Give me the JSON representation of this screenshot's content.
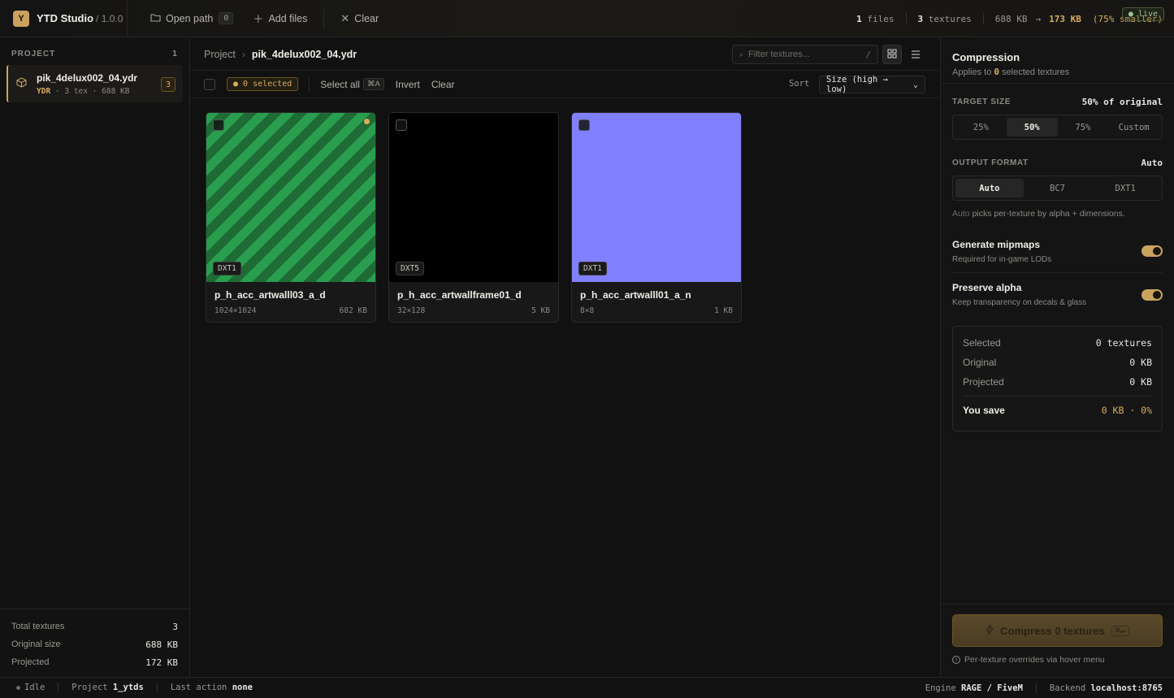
{
  "app": {
    "logo_letter": "Y",
    "name": "YTD Studio",
    "version": "/ 1.0.0"
  },
  "toolbar": {
    "open_path": "Open path",
    "open_path_count": "0",
    "add_files": "Add files",
    "clear": "Clear"
  },
  "stats": {
    "files_num": "1",
    "files_lbl": "files",
    "textures_num": "3",
    "textures_lbl": "textures",
    "size_from": "688 KB",
    "arrow": "→",
    "size_to": "173 KB",
    "saving": "(75% smaller)",
    "live": "● live"
  },
  "sidebar": {
    "header": "PROJECT",
    "count": "1",
    "file": {
      "name": "pik_4delux002_04.ydr",
      "type": "YDR",
      "tex": "3 tex",
      "size": "688 KB",
      "badge": "3"
    },
    "footer": {
      "total_label": "Total textures",
      "total_value": "3",
      "original_label": "Original size",
      "original_value": "688 KB",
      "projected_label": "Projected",
      "projected_value": "172 KB"
    }
  },
  "main": {
    "crumb_root": "Project",
    "crumb_current": "pik_4delux002_04.ydr",
    "filter_placeholder": "Filter textures...",
    "filter_shortcut": "/",
    "selected_pill": "● 0 selected",
    "select_all": "Select all",
    "select_all_kbd": "⌘A",
    "invert": "Invert",
    "clear": "Clear",
    "sort_label": "Sort",
    "sort_value": "Size (high → low)",
    "cards": [
      {
        "name": "p_h_acc_artwalll03_a_d",
        "format": "DXT1",
        "dims": "1024×1024",
        "size": "682 KB"
      },
      {
        "name": "p_h_acc_artwallframe01_d",
        "format": "DXT5",
        "dims": "32×128",
        "size": "5 KB"
      },
      {
        "name": "p_h_acc_artwalll01_a_n",
        "format": "DXT1",
        "dims": "8×8",
        "size": "1 KB"
      }
    ]
  },
  "panel": {
    "title": "Compression",
    "applies_pre": "Applies to",
    "applies_num": "0",
    "applies_post": "selected textures",
    "target_label": "TARGET SIZE",
    "target_value": "50% of original",
    "target_opts": [
      "25%",
      "50%",
      "75%",
      "Custom"
    ],
    "format_label": "OUTPUT FORMAT",
    "format_value": "Auto",
    "format_opts": [
      "Auto",
      "BC7",
      "DXT1"
    ],
    "hint_a": "Auto",
    "hint_b": "picks per-texture by alpha + dimensions.",
    "mipmaps_title": "Generate mipmaps",
    "mipmaps_sub": "Required for in-game LODs",
    "alpha_title": "Preserve alpha",
    "alpha_sub": "Keep transparency on decals & glass",
    "summary": {
      "selected_k": "Selected",
      "selected_v": "0 textures",
      "original_k": "Original",
      "original_v": "0 KB",
      "projected_k": "Projected",
      "projected_v": "0 KB",
      "save_k": "You save",
      "save_v": "0 KB · 0%"
    },
    "compress_btn": "Compress 0 textures",
    "compress_kbd": "⌘↵",
    "note": "Per-texture overrides via hover menu"
  },
  "status": {
    "idle": "Idle",
    "project_k": "Project",
    "project_v": "1_ytds",
    "action_k": "Last action",
    "action_v": "none",
    "engine_k": "Engine",
    "engine_v": "RAGE / FiveM",
    "backend_k": "Backend",
    "backend_v": "localhost:8765"
  },
  "colors": {
    "accent": "#c9a35d",
    "stripe_a": "#2a9e4f",
    "stripe_b": "#1f6b35",
    "normal_blue": "#8080ff"
  },
  "icons": [
    "folder-icon",
    "plus-icon",
    "x-icon",
    "cube-icon",
    "grid-icon",
    "list-icon",
    "bolt-icon",
    "info-icon",
    "chevron-right-icon"
  ]
}
